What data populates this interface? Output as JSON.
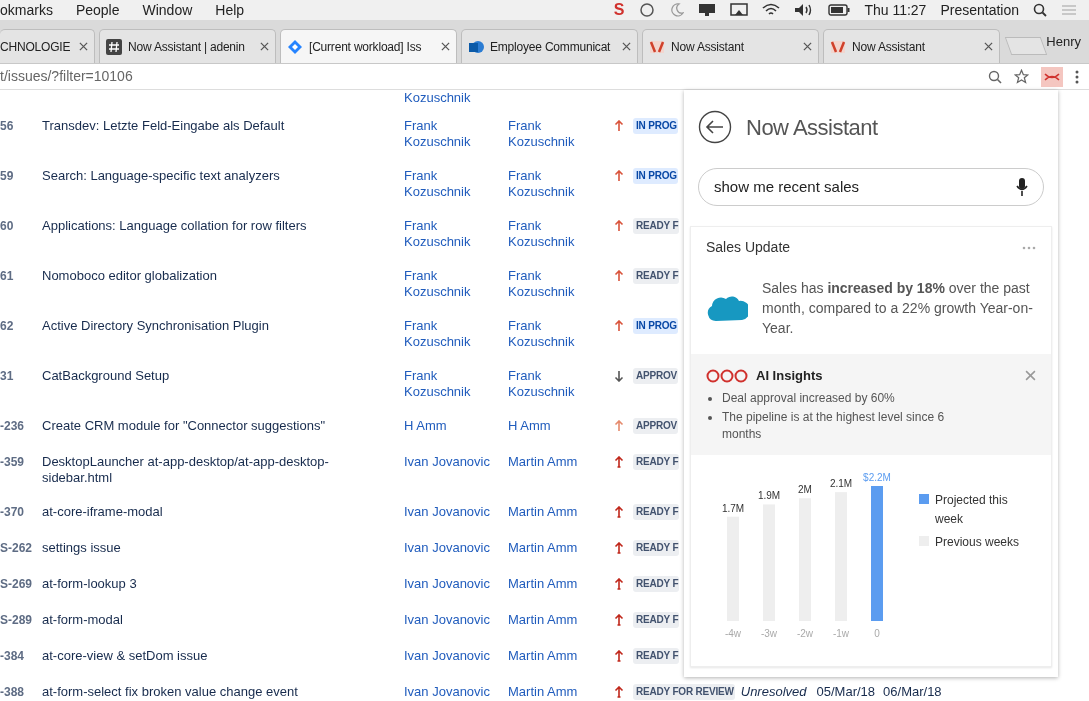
{
  "menu_bar": {
    "items": [
      "okmarks",
      "People",
      "Window",
      "Help"
    ],
    "app_letter": "S",
    "clock": "Thu 11:27",
    "profile": "Presentation"
  },
  "tabs": [
    {
      "label": "CHNOLOGIE",
      "selected": false,
      "kind": "plain"
    },
    {
      "label": "Now Assistant | adenin",
      "selected": false,
      "kind": "hash"
    },
    {
      "label": "[Current workload] Iss",
      "selected": true,
      "kind": "diamond"
    },
    {
      "label": "Employee Communicat",
      "selected": false,
      "kind": "document"
    },
    {
      "label": "Now Assistant",
      "selected": false,
      "kind": "app"
    },
    {
      "label": "Now Assistant",
      "selected": false,
      "kind": "app"
    }
  ],
  "user": "Henry",
  "address": "t/issues/?filter=10106",
  "table": {
    "partial_row": {
      "assignee": "Kozuschnik"
    },
    "rows": [
      {
        "key": "56",
        "summary": "Transdev: Letzte Feld-Eingabe als Default",
        "assignee": "Frank Kozuschnik",
        "reporter": "Frank Kozuschnik",
        "priority": {
          "kind": "high"
        },
        "status": {
          "text": "IN PROG",
          "kind": "progress"
        }
      },
      {
        "key": "59",
        "summary": "Search: Language-specific text analyzers",
        "assignee": "Frank Kozuschnik",
        "reporter": "Frank Kozuschnik",
        "priority": {
          "kind": "high"
        },
        "status": {
          "text": "IN PROG",
          "kind": "progress"
        }
      },
      {
        "key": "60",
        "summary": "Applications: Language collation for row filters",
        "assignee": "Frank Kozuschnik",
        "reporter": "Frank Kozuschnik",
        "priority": {
          "kind": "high"
        },
        "status": {
          "text": "READY F",
          "kind": "plain"
        }
      },
      {
        "key": "61",
        "summary": "Nomoboco editor globalization",
        "assignee": "Frank Kozuschnik",
        "reporter": "Frank Kozuschnik",
        "priority": {
          "kind": "high"
        },
        "status": {
          "text": "READY F",
          "kind": "plain"
        }
      },
      {
        "key": "62",
        "summary": "Active Directory Synchronisation Plugin",
        "assignee": "Frank Kozuschnik",
        "reporter": "Frank Kozuschnik",
        "priority": {
          "kind": "high"
        },
        "status": {
          "text": "IN PROG",
          "kind": "progress"
        }
      },
      {
        "key": "31",
        "summary": "CatBackground Setup",
        "assignee": "Frank Kozuschnik",
        "reporter": "Frank Kozuschnik",
        "priority": {
          "kind": "low"
        },
        "status": {
          "text": "APPROV",
          "kind": "plain"
        }
      },
      {
        "key": "-236",
        "summary": "Create CRM module for \"Connector suggestions\"",
        "assignee": "H Amm",
        "reporter": "H Amm",
        "priority": {
          "kind": "medium"
        },
        "status": {
          "text": "APPROV",
          "kind": "plain"
        }
      },
      {
        "key": "-359",
        "summary": "DesktopLauncher at-app-desktop/at-app-desktop-sidebar.html",
        "assignee": "Ivan Jovanovic",
        "reporter": "Martin Amm",
        "priority": {
          "kind": "highest"
        },
        "status": {
          "text": "READY F",
          "kind": "plain"
        }
      },
      {
        "key": "-370",
        "summary": "at-core-iframe-modal",
        "assignee": "Ivan Jovanovic",
        "reporter": "Martin Amm",
        "priority": {
          "kind": "highest"
        },
        "status": {
          "text": "READY F",
          "kind": "plain"
        }
      },
      {
        "key": "S-262",
        "summary": "settings issue",
        "assignee": "Ivan Jovanovic",
        "reporter": "Martin Amm",
        "priority": {
          "kind": "highest"
        },
        "status": {
          "text": "READY F",
          "kind": "plain"
        }
      },
      {
        "key": "S-269",
        "summary": "at-form-lookup 3",
        "assignee": "Ivan Jovanovic",
        "reporter": "Martin Amm",
        "priority": {
          "kind": "highest"
        },
        "status": {
          "text": "READY F",
          "kind": "plain"
        }
      },
      {
        "key": "S-289",
        "summary": "at-form-modal",
        "assignee": "Ivan Jovanovic",
        "reporter": "Martin Amm",
        "priority": {
          "kind": "highest"
        },
        "status": {
          "text": "READY F",
          "kind": "plain"
        }
      },
      {
        "key": "-384",
        "summary": "at-core-view & setDom issue",
        "assignee": "Ivan Jovanovic",
        "reporter": "Martin Amm",
        "priority": {
          "kind": "highest"
        },
        "status": {
          "text": "READY F",
          "kind": "plain"
        }
      },
      {
        "key": "-388",
        "summary": "at-form-select fix broken value change event",
        "assignee": "Ivan Jovanovic",
        "reporter": "Martin Amm",
        "priority": {
          "kind": "highest"
        },
        "status": {
          "text": "READY FOR REVIEW",
          "kind": "plain"
        },
        "resolution": "Unresolved",
        "created": "05/Mar/18",
        "updated": "06/Mar/18"
      }
    ]
  },
  "assistant": {
    "title": "Now Assistant",
    "query": "show me recent sales",
    "card": {
      "title": "Sales Update",
      "text": "Sales has **increased by 18%** over the past month, compared to a 22% growth Year-on-Year.",
      "insights": {
        "title": "AI Insights",
        "bullets": [
          "Deal approval increased by 60%",
          "The pipeline is at the highest level since 6 months"
        ]
      },
      "chart_data": {
        "type": "bar",
        "categories": [
          "-4w",
          "-3w",
          "-2w",
          "-1w",
          "0"
        ],
        "series": [
          {
            "name": "Projected this week",
            "color": "#5b9cf0",
            "values": [
              null,
              null,
              null,
              null,
              2.2
            ],
            "value_labels": [
              null,
              null,
              null,
              null,
              "$2.2M"
            ]
          },
          {
            "name": "Previous weeks",
            "color": "#eeeeee",
            "values": [
              1.7,
              1.9,
              2,
              2.1,
              null
            ],
            "value_labels": [
              "1.7M",
              "1.9M",
              "2M",
              "2.1M",
              null
            ]
          }
        ]
      }
    }
  }
}
